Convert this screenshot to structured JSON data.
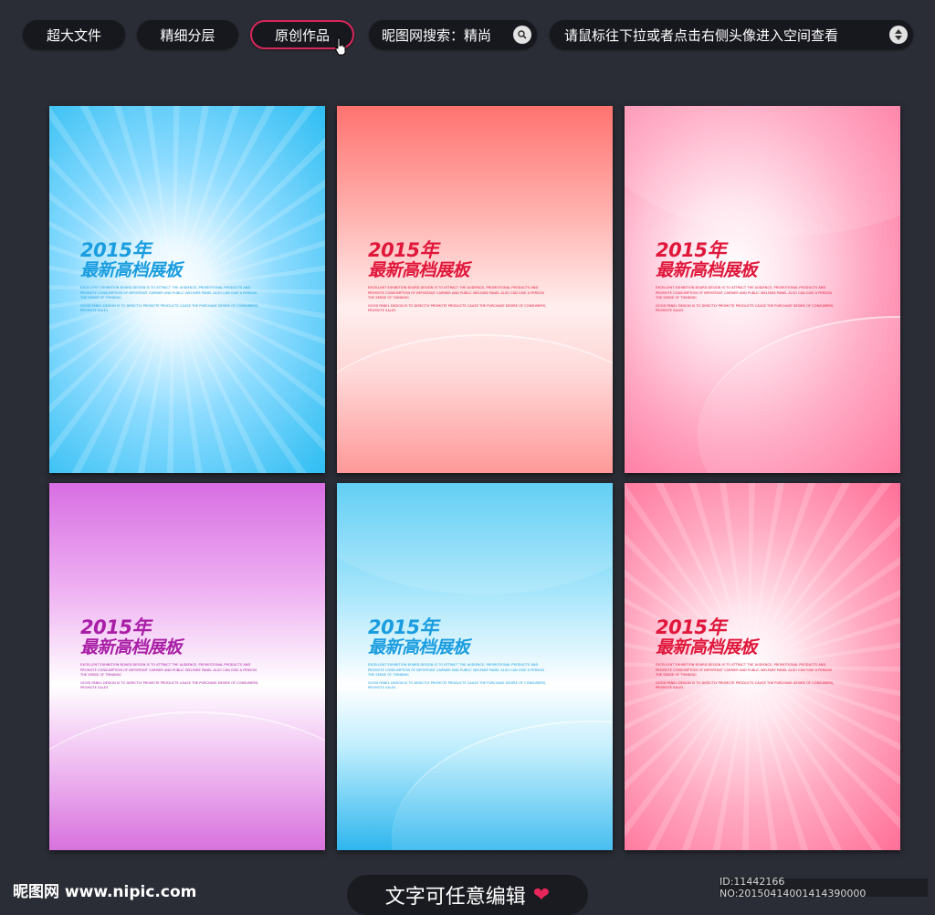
{
  "toolbar": {
    "btn_large_file": "超大文件",
    "btn_fine_layers": "精细分层",
    "btn_original": "原创作品",
    "search_label": "昵图网搜索：精尚",
    "hint_label": "请鼠标往下拉或者点击右侧头像进入空间查看",
    "search_icon": "magnifier-icon",
    "scroll_icon": "up-down-arrows-icon",
    "accent_color": "#d9275a"
  },
  "posters": [
    {
      "year": "2015年",
      "title": "最新高档展板",
      "body": [
        "EXCELLENT EXHIBITION BOARD DESIGN IS TO ATTRACT THE AUDIENCE, PROMOTIONAL PRODUCTS AND PROMOTE CONSUMPTION OF IMPORTANT CARRIER AND PUBLIC WELFARE PANEL ALSO CAN GIVE A PERSON THE SENSE OF THINKING",
        "GOOD PANEL DESIGN IS TO DIRECTLY PROMOTE PRODUCTS CAUSE THE PURCHASE DESIRE OF CONSUMERS, PROMOTE SALES"
      ]
    },
    {
      "year": "2015年",
      "title": "最新高档展板",
      "body": [
        "EXCELLENT EXHIBITION BOARD DESIGN IS TO ATTRACT THE AUDIENCE, PROMOTIONAL PRODUCTS AND PROMOTE CONSUMPTION OF IMPORTANT CARRIER AND PUBLIC WELFARE PANEL ALSO CAN GIVE A PERSON THE SENSE OF THINKING",
        "GOOD PANEL DESIGN IS TO DIRECTLY PROMOTE PRODUCTS CAUSE THE PURCHASE DESIRE OF CONSUMERS, PROMOTE SALES"
      ]
    },
    {
      "year": "2015年",
      "title": "最新高档展板",
      "body": [
        "EXCELLENT EXHIBITION BOARD DESIGN IS TO ATTRACT THE AUDIENCE, PROMOTIONAL PRODUCTS AND PROMOTE CONSUMPTION OF IMPORTANT CARRIER AND PUBLIC WELFARE PANEL ALSO CAN GIVE A PERSON THE SENSE OF THINKING",
        "GOOD PANEL DESIGN IS TO DIRECTLY PROMOTE PRODUCTS CAUSE THE PURCHASE DESIRE OF CONSUMERS, PROMOTE SALES"
      ]
    },
    {
      "year": "2015年",
      "title": "最新高档展板",
      "body": [
        "EXCELLENT EXHIBITION BOARD DESIGN IS TO ATTRACT THE AUDIENCE, PROMOTIONAL PRODUCTS AND PROMOTE CONSUMPTION OF IMPORTANT CARRIER AND PUBLIC WELFARE PANEL ALSO CAN GIVE A PERSON THE SENSE OF THINKING",
        "GOOD PANEL DESIGN IS TO DIRECTLY PROMOTE PRODUCTS CAUSE THE PURCHASE DESIRE OF CONSUMERS, PROMOTE SALES"
      ]
    },
    {
      "year": "2015年",
      "title": "最新高档展板",
      "body": [
        "EXCELLENT EXHIBITION BOARD DESIGN IS TO ATTRACT THE AUDIENCE, PROMOTIONAL PRODUCTS AND PROMOTE CONSUMPTION OF IMPORTANT CARRIER AND PUBLIC WELFARE PANEL ALSO CAN GIVE A PERSON THE SENSE OF THINKING",
        "GOOD PANEL DESIGN IS TO DIRECTLY PROMOTE PRODUCTS CAUSE THE PURCHASE DESIRE OF CONSUMERS, PROMOTE SALES"
      ]
    },
    {
      "year": "2015年",
      "title": "最新高档展板",
      "body": [
        "EXCELLENT EXHIBITION BOARD DESIGN IS TO ATTRACT THE AUDIENCE, PROMOTIONAL PRODUCTS AND PROMOTE CONSUMPTION OF IMPORTANT CARRIER AND PUBLIC WELFARE PANEL ALSO CAN GIVE A PERSON THE SENSE OF THINKING",
        "GOOD PANEL DESIGN IS TO DIRECTLY PROMOTE PRODUCTS CAUSE THE PURCHASE DESIRE OF CONSUMERS, PROMOTE SALES"
      ]
    }
  ],
  "poster_colors": [
    "#1a9de0",
    "#e0173b",
    "#e0173b",
    "#a91ea6",
    "#1a9de0",
    "#e0173b"
  ],
  "footer": {
    "logo_text": "昵图网 www.nipic.com",
    "edit_label": "文字可任意编辑",
    "heart_icon": "heart-icon",
    "id_text": "ID:11442166 NO:20150414001414390000"
  }
}
